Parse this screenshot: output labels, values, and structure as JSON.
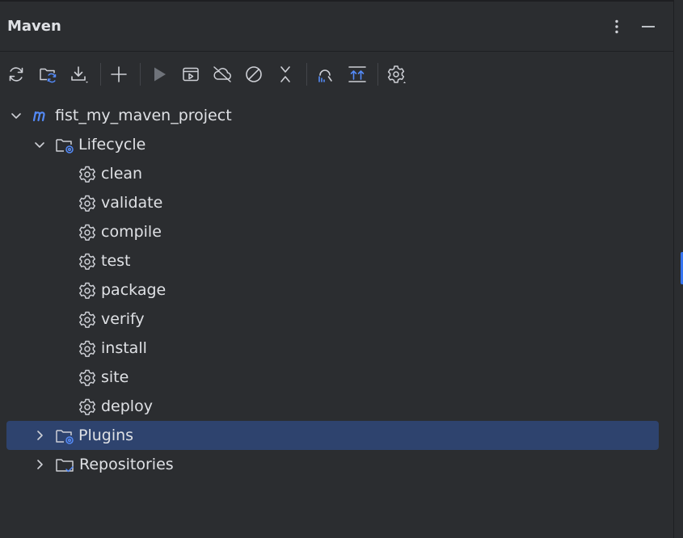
{
  "panel": {
    "title": "Maven"
  },
  "header_buttons": [
    {
      "name": "more-options-icon"
    },
    {
      "name": "hide-panel-icon"
    }
  ],
  "toolbar": [
    {
      "name": "reload-icon",
      "tooltip": ""
    },
    {
      "name": "generate-sources-icon"
    },
    {
      "name": "download-icon"
    },
    {
      "name": "add-maven-project-icon"
    },
    {
      "name": "run-icon"
    },
    {
      "name": "run-configuration-icon"
    },
    {
      "name": "offline-mode-icon"
    },
    {
      "name": "skip-tests-icon"
    },
    {
      "name": "collapse-all-icon"
    },
    {
      "name": "analyze-dependencies-icon"
    },
    {
      "name": "show-dependencies-icon"
    },
    {
      "name": "settings-icon"
    }
  ],
  "tree": {
    "project": {
      "label": "fist_my_maven_project",
      "icon": "maven-m-icon",
      "expanded": true
    },
    "lifecycle": {
      "label": "Lifecycle",
      "expanded": true,
      "goals": [
        "clean",
        "validate",
        "compile",
        "test",
        "package",
        "verify",
        "install",
        "site",
        "deploy"
      ]
    },
    "plugins": {
      "label": "Plugins",
      "expanded": false,
      "selected": true
    },
    "repositories": {
      "label": "Repositories",
      "expanded": false
    }
  },
  "colors": {
    "background": "#2b2d30",
    "selection": "#2e436e",
    "accent": "#3574f0",
    "text": "#dfe1e5",
    "icon": "#ced0d6"
  }
}
